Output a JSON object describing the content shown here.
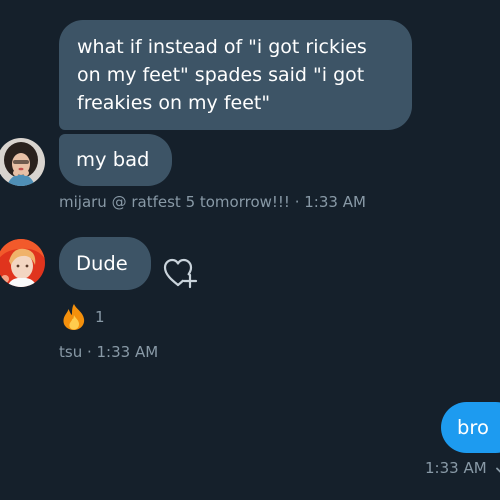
{
  "conversation": {
    "messages": [
      {
        "lines": [
          "what if instead of \"i got rickies",
          "on my feet\" spades said \"i got",
          "freakies on my feet\""
        ]
      },
      {
        "text": "my bad"
      },
      {
        "text": "Dude"
      },
      {
        "text": "bro"
      }
    ],
    "meta": {
      "mijaru": "mijaru @ ratfest 5 tomorrow!!! · 1:33 AM",
      "tsu": "tsu · 1:33 AM",
      "outgoing": "1:33 AM"
    },
    "reaction": {
      "emoji_icon": "fire-icon",
      "count": "1"
    }
  },
  "colors": {
    "background": "#15202b",
    "incoming_bubble": "#3d5466",
    "outgoing_bubble": "#1d9bf0",
    "meta_text": "#8899a6"
  }
}
